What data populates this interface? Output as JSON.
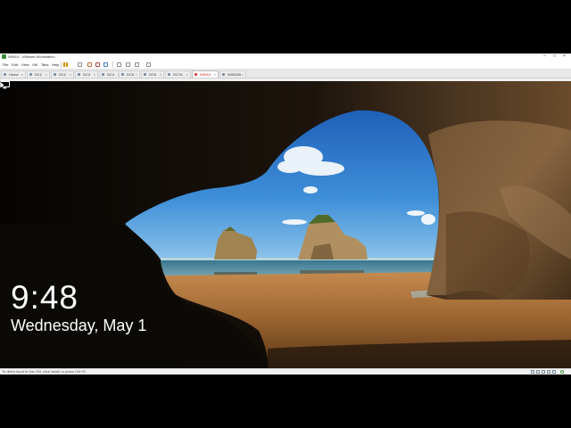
{
  "window": {
    "title": "WIN10 - VMware Workstation",
    "controls": {
      "minimize": "–",
      "maximize": "□",
      "close": "×"
    }
  },
  "menu": {
    "items": [
      "File",
      "Edit",
      "View",
      "VM",
      "Tabs",
      "Help"
    ]
  },
  "tabs": [
    {
      "label": "Home",
      "active": false
    },
    {
      "label": "DC1",
      "active": false
    },
    {
      "label": "DC2",
      "active": false
    },
    {
      "label": "DC3",
      "active": false
    },
    {
      "label": "DC4",
      "active": false
    },
    {
      "label": "DC5",
      "active": false
    },
    {
      "label": "DC6",
      "active": false
    },
    {
      "label": "DC7A",
      "active": false
    },
    {
      "label": "WIN10",
      "active": true
    },
    {
      "label": "WIN10B",
      "active": false
    }
  ],
  "lockscreen": {
    "time": "9:48",
    "date": "Wednesday, May 1"
  },
  "status": {
    "text": "To direct input to this VM, click inside or press Ctrl+G."
  }
}
